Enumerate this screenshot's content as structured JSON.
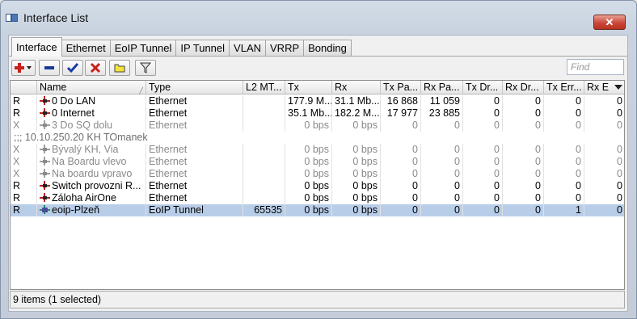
{
  "window": {
    "title": "Interface List",
    "close_label": "✕"
  },
  "tabs": [
    {
      "label": "Interface"
    },
    {
      "label": "Ethernet"
    },
    {
      "label": "EoIP Tunnel"
    },
    {
      "label": "IP Tunnel"
    },
    {
      "label": "VLAN"
    },
    {
      "label": "VRRP"
    },
    {
      "label": "Bonding"
    }
  ],
  "toolbar": {
    "add_icon": "plus-dropdown-icon",
    "remove_icon": "minus-icon",
    "enable_icon": "checkmark-icon",
    "disable_icon": "x-icon",
    "comment_icon": "comment-icon",
    "filter_icon": "filter-icon",
    "find_placeholder": "Find"
  },
  "columns": {
    "flag": "",
    "name": "Name",
    "type": "Type",
    "l2mtu": "L2 MT...",
    "tx": "Tx",
    "rx": "Rx",
    "txpa": "Tx Pa...",
    "rxpa": "Rx Pa...",
    "txdr": "Tx Dr...",
    "rxdr": "Rx Dr...",
    "txerr": "Tx Err...",
    "rxe": "Rx E"
  },
  "rows": [
    {
      "flag": "R",
      "name": "0 Do LAN",
      "type": "Ethernet",
      "l2mtu": "",
      "tx": "177.9 M...",
      "rx": "31.1 Mb...",
      "txpa": "16 868",
      "rxpa": "11 059",
      "txdr": "0",
      "rxdr": "0",
      "txerr": "0",
      "rxe": "0",
      "disabled": false,
      "selected": false
    },
    {
      "flag": "R",
      "name": "0 Internet",
      "type": "Ethernet",
      "l2mtu": "",
      "tx": "35.1 Mb...",
      "rx": "182.2 M...",
      "txpa": "17 977",
      "rxpa": "23 885",
      "txdr": "0",
      "rxdr": "0",
      "txerr": "0",
      "rxe": "0",
      "disabled": false,
      "selected": false
    },
    {
      "flag": "X",
      "name": "3 Do SQ dolu",
      "type": "Ethernet",
      "l2mtu": "",
      "tx": "0 bps",
      "rx": "0 bps",
      "txpa": "0",
      "rxpa": "0",
      "txdr": "0",
      "rxdr": "0",
      "txerr": "0",
      "rxe": "0",
      "disabled": true,
      "selected": false
    },
    {
      "comment": ";;; 10.10.250.20 KH TOmanek"
    },
    {
      "flag": "X",
      "name": "Bývalý KH, Via",
      "type": "Ethernet",
      "l2mtu": "",
      "tx": "0 bps",
      "rx": "0 bps",
      "txpa": "0",
      "rxpa": "0",
      "txdr": "0",
      "rxdr": "0",
      "txerr": "0",
      "rxe": "0",
      "disabled": true,
      "selected": false
    },
    {
      "flag": "X",
      "name": "Na Boardu vlevo",
      "type": "Ethernet",
      "l2mtu": "",
      "tx": "0 bps",
      "rx": "0 bps",
      "txpa": "0",
      "rxpa": "0",
      "txdr": "0",
      "rxdr": "0",
      "txerr": "0",
      "rxe": "0",
      "disabled": true,
      "selected": false
    },
    {
      "flag": "X",
      "name": "Na boardu vpravo",
      "type": "Ethernet",
      "l2mtu": "",
      "tx": "0 bps",
      "rx": "0 bps",
      "txpa": "0",
      "rxpa": "0",
      "txdr": "0",
      "rxdr": "0",
      "txerr": "0",
      "rxe": "0",
      "disabled": true,
      "selected": false
    },
    {
      "flag": "R",
      "name": "Switch provozni R...",
      "type": "Ethernet",
      "l2mtu": "",
      "tx": "0 bps",
      "rx": "0 bps",
      "txpa": "0",
      "rxpa": "0",
      "txdr": "0",
      "rxdr": "0",
      "txerr": "0",
      "rxe": "0",
      "disabled": false,
      "selected": false
    },
    {
      "flag": "R",
      "name": "Záloha AirOne",
      "type": "Ethernet",
      "l2mtu": "",
      "tx": "0 bps",
      "rx": "0 bps",
      "txpa": "0",
      "rxpa": "0",
      "txdr": "0",
      "rxdr": "0",
      "txerr": "0",
      "rxe": "0",
      "disabled": false,
      "selected": false
    },
    {
      "flag": "R",
      "name": "eoip-Plzeň",
      "type": "EoIP Tunnel",
      "l2mtu": "65535",
      "tx": "0 bps",
      "rx": "0 bps",
      "txpa": "0",
      "rxpa": "0",
      "txdr": "0",
      "rxdr": "0",
      "txerr": "1",
      "rxe": "0",
      "disabled": false,
      "selected": true,
      "eoip": true
    }
  ],
  "status": {
    "text": "9 items (1 selected)"
  }
}
